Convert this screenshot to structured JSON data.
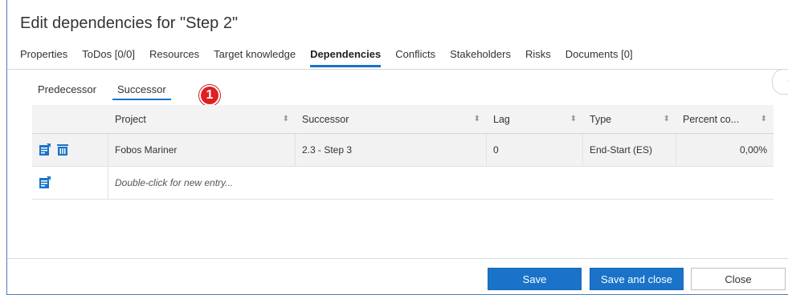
{
  "dialog": {
    "title": "Edit dependencies for \"Step 2\"",
    "help_label": "?"
  },
  "tabs": [
    {
      "label": "Properties",
      "active": false
    },
    {
      "label": "ToDos [0/0]",
      "active": false
    },
    {
      "label": "Resources",
      "active": false
    },
    {
      "label": "Target knowledge",
      "active": false
    },
    {
      "label": "Dependencies",
      "active": true
    },
    {
      "label": "Conflicts",
      "active": false
    },
    {
      "label": "Stakeholders",
      "active": false
    },
    {
      "label": "Risks",
      "active": false
    },
    {
      "label": "Documents [0]",
      "active": false
    }
  ],
  "subtabs": [
    {
      "label": "Predecessor",
      "active": false
    },
    {
      "label": "Successor",
      "active": true
    }
  ],
  "callout": {
    "number": "1"
  },
  "grid": {
    "columns": [
      "Project",
      "Successor",
      "Lag",
      "Type",
      "Percent co..."
    ],
    "rows": [
      {
        "project": "Fobos Mariner",
        "successor": "2.3 - Step 3",
        "lag": "0",
        "type": "End-Start (ES)",
        "percent": "0,00%"
      }
    ],
    "new_entry_placeholder": "Double-click for new entry..."
  },
  "footer": {
    "save": "Save",
    "save_and_close": "Save and close",
    "close": "Close"
  },
  "colors": {
    "accent": "#1a73c9",
    "callout": "#e11f1f"
  },
  "icons": {
    "edit": "edit-icon",
    "delete": "trash-icon",
    "sort": "sort-icon"
  }
}
